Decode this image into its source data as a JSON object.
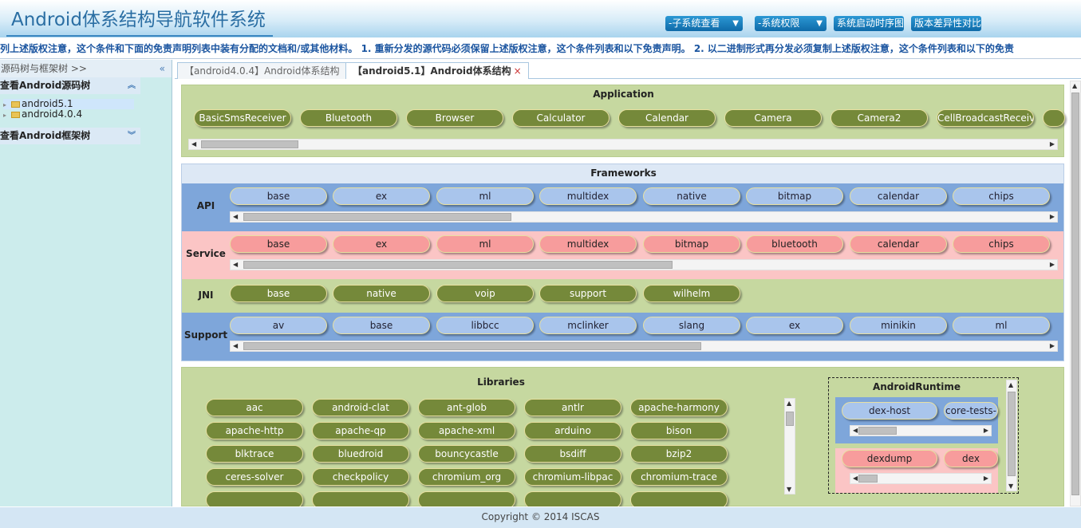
{
  "header": {
    "title": "Android体系结构导航软件系统",
    "nav": [
      {
        "label": "-子系统查看"
      },
      {
        "label": "-系统权限"
      },
      {
        "label": "系统启动时序图"
      },
      {
        "label": "版本差异性对比"
      }
    ]
  },
  "marquee": {
    "text": "列上述版权注意，这个条件和下面的免责声明列表中装有分配的文档和/或其他材料。 1. 重新分发的源代码必须保留上述版权注意，这个条件列表和以下免责声明。 2. 以二进制形式再分发必须复制上述版权注意，这个条件列表和以下的免责"
  },
  "sidebar": {
    "title": "源码树与框架树 >>",
    "collapse_icon": "«",
    "source_tree_label": "查看Android源码树",
    "framework_tree_label": "查看Android框架树",
    "nodes": [
      {
        "label": "android5.1"
      },
      {
        "label": "android4.0.4"
      }
    ]
  },
  "tabs": [
    {
      "label": "【android4.0.4】Android体系结构"
    },
    {
      "label": "【android5.1】Android体系结构",
      "close": "×"
    }
  ],
  "application": {
    "title": "Application",
    "items": [
      "BasicSmsReceiver",
      "Bluetooth",
      "Browser",
      "Calculator",
      "Calendar",
      "Camera",
      "Camera2",
      "CellBroadcastReceiver"
    ]
  },
  "frameworks": {
    "title": "Frameworks",
    "api": {
      "label": "API",
      "items": [
        "base",
        "ex",
        "ml",
        "multidex",
        "native",
        "bitmap",
        "calendar",
        "chips"
      ]
    },
    "service": {
      "label": "Service",
      "items": [
        "base",
        "ex",
        "ml",
        "multidex",
        "bitmap",
        "bluetooth",
        "calendar",
        "chips"
      ]
    },
    "jni": {
      "label": "JNI",
      "items": [
        "base",
        "native",
        "voip",
        "support",
        "wilhelm"
      ]
    },
    "support": {
      "label": "Support",
      "items": [
        "av",
        "base",
        "libbcc",
        "mclinker",
        "slang",
        "ex",
        "minikin",
        "ml"
      ]
    }
  },
  "libraries": {
    "title": "Libraries",
    "items": [
      "aac",
      "android-clat",
      "ant-glob",
      "antlr",
      "apache-harmony",
      "apache-http",
      "apache-qp",
      "apache-xml",
      "arduino",
      "bison",
      "blktrace",
      "bluedroid",
      "bouncycastle",
      "bsdiff",
      "bzip2",
      "ceres-solver",
      "checkpolicy",
      "chromium_org",
      "chromium-libpac",
      "chromium-trace"
    ]
  },
  "runtime": {
    "title": "AndroidRuntime",
    "row1": [
      "dex-host",
      "core-tests-"
    ],
    "row2": [
      "dexdump",
      "dex"
    ]
  },
  "footer": {
    "text": "Copyright © 2014 ISCAS"
  },
  "colors": {
    "olive": "#75893a",
    "blue_pill": "#a9c5ec",
    "pink_pill": "#f79c9c",
    "app_bg": "#c6d8a0",
    "api_row": "#7ea6da",
    "service_row": "#fbc5c5"
  }
}
